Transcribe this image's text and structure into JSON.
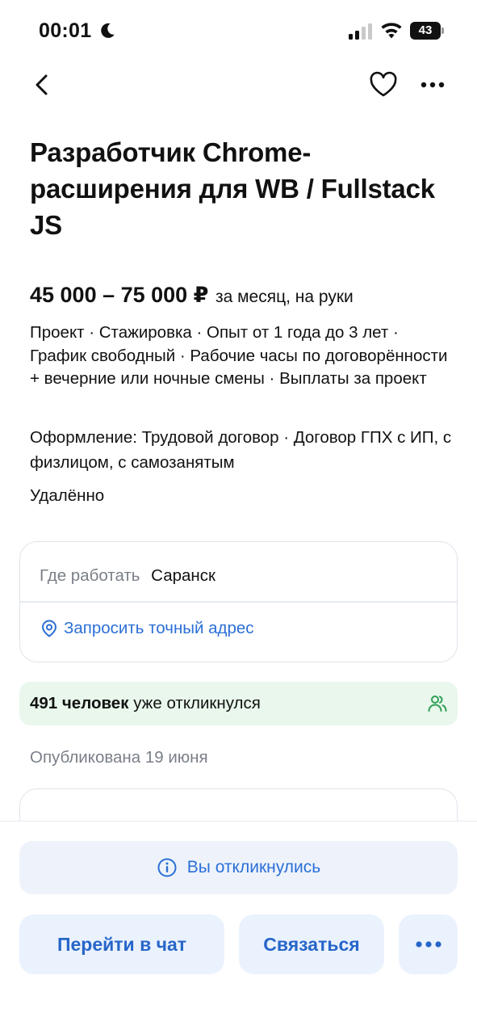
{
  "status_bar": {
    "time": "00:01",
    "battery": "43"
  },
  "vacancy": {
    "title": "Разработчик Chrome-расширения для WB / Fullstack JS",
    "salary_amount": "45 000 – 75 000 ₽",
    "salary_note": "за месяц, на руки",
    "details": "Проект · Стажировка · Опыт от 1 года до 3 лет · График свободный · Рабочие часы по договорённости + вечерние или ночные смены · Выплаты за проект",
    "contract": "Оформление: Трудовой договор · Договор ГПХ с ИП, с физлицом, с самозанятым",
    "remote": "Удалённо"
  },
  "location": {
    "label": "Где работать",
    "city": "Саранск",
    "request_address": "Запросить точный адрес"
  },
  "responses": {
    "count": "491 человек",
    "suffix": "уже откликнулся"
  },
  "published": "Опубликована 19 июня",
  "actions": {
    "responded": "Вы откликнулись",
    "chat": "Перейти в чат",
    "contact": "Связаться"
  },
  "colors": {
    "accent": "#2b6fd6",
    "button_bg": "#eaf2fd",
    "success_bg": "#e9f7ec",
    "success_icon": "#2f9e55",
    "muted_text": "#7a7f88"
  },
  "icons": {
    "back": "chevron-left-icon",
    "favorite": "heart-icon",
    "more": "more-horizontal-icon",
    "location": "location-pin-icon",
    "people": "people-icon",
    "info": "info-icon"
  }
}
